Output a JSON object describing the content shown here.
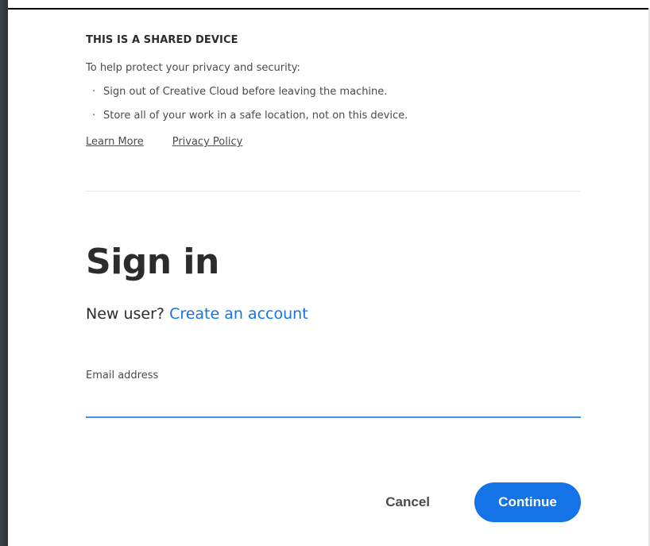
{
  "notice": {
    "title": "THIS IS A SHARED DEVICE",
    "intro": "To help protect your privacy and security:",
    "bullets": [
      "Sign out of Creative Cloud before leaving the machine.",
      "Store all of your work in a safe location, not on this device."
    ],
    "learn_more": "Learn More",
    "privacy_policy": "Privacy Policy"
  },
  "signin": {
    "title": "Sign in",
    "new_user_prefix": "New user?",
    "create_account": "Create an account",
    "email_label": "Email address",
    "email_value": ""
  },
  "actions": {
    "cancel": "Cancel",
    "continue": "Continue"
  },
  "colors": {
    "accent": "#1473e6",
    "input_underline": "#4d8ee8",
    "text_dark": "#2c2c2c",
    "text_muted": "#4b4b4b"
  }
}
